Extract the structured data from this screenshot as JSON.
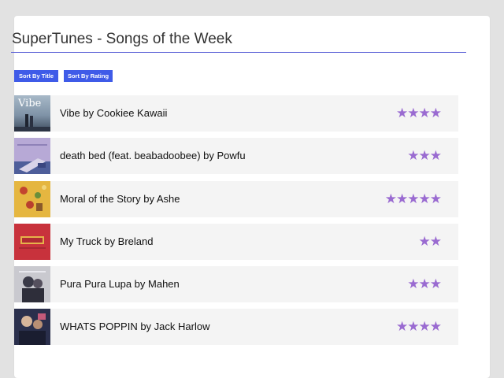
{
  "app": {
    "title": "SuperTunes - Songs of the Week"
  },
  "toolbar": {
    "sort_title_label": "Sort By Title",
    "sort_rating_label": "Sort By Rating"
  },
  "colors": {
    "accent": "#3f5be8",
    "rule": "#5a5fd6",
    "star": "#9a6bd1",
    "row_background": "#f4f4f4"
  },
  "songs": [
    {
      "label": "Vibe by Cookiee Kawaii",
      "rating": 4,
      "cover_text": "Vibe",
      "cover_icon": "album-cover-vibe"
    },
    {
      "label": "death bed (feat. beabadoobee) by Powfu",
      "rating": 3,
      "cover_text": "",
      "cover_icon": "album-cover-death-bed"
    },
    {
      "label": "Moral of the Story by Ashe",
      "rating": 5,
      "cover_text": "",
      "cover_icon": "album-cover-moral-of-the-story"
    },
    {
      "label": "My Truck by Breland",
      "rating": 2,
      "cover_text": "",
      "cover_icon": "album-cover-my-truck"
    },
    {
      "label": "Pura Pura Lupa by Mahen",
      "rating": 3,
      "cover_text": "",
      "cover_icon": "album-cover-pura-pura-lupa"
    },
    {
      "label": "WHATS POPPIN by Jack Harlow",
      "rating": 4,
      "cover_text": "",
      "cover_icon": "album-cover-whats-poppin"
    }
  ]
}
